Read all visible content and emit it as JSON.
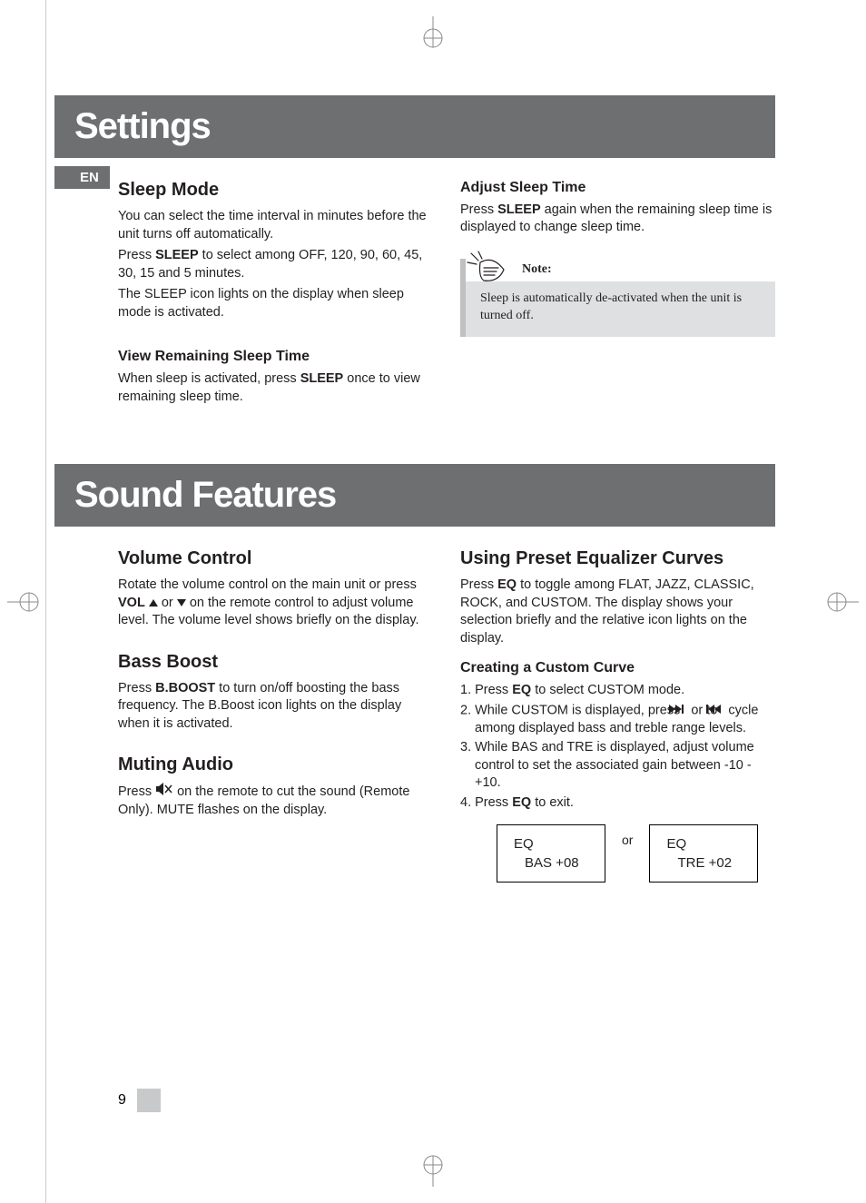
{
  "lang_tab": "EN",
  "page_number": "9",
  "settings": {
    "title": "Settings",
    "left": {
      "sleep_mode": {
        "title": "Sleep Mode",
        "p1": "You can select the time interval in minutes before the unit turns off automatically.",
        "p2a": "Press ",
        "p2b": "SLEEP",
        "p2c": " to select among OFF, 120, 90, 60, 45, 30, 15 and  5 minutes.",
        "p3": "The SLEEP icon lights on the display when sleep mode is activated."
      },
      "view_remaining": {
        "title": "View Remaining Sleep Time",
        "p1a": "When sleep is activated, press ",
        "p1b": "SLEEP",
        "p1c": " once to view remaining sleep time."
      }
    },
    "right": {
      "adjust_sleep": {
        "title": "Adjust Sleep Time",
        "p1a": "Press ",
        "p1b": "SLEEP",
        "p1c": " again when the remaining sleep time is displayed to change sleep time."
      },
      "note": {
        "label": "Note:",
        "body": "Sleep is automatically de-activated when the unit is turned off."
      }
    }
  },
  "sound": {
    "title": "Sound Features",
    "left": {
      "volume": {
        "title": "Volume Control",
        "p1a": "Rotate the volume control on the main unit or press ",
        "p1b": "VOL",
        "p1c": "  or  ",
        "p1d": "  on the remote control to adjust volume level. The volume level shows briefly on the display."
      },
      "bass": {
        "title": "Bass Boost",
        "p1a": "Press ",
        "p1b": "B.BOOST",
        "p1c": "  to turn on/off boosting the bass frequency. The B.Boost icon lights on the display when it is activated."
      },
      "mute": {
        "title": "Muting Audio",
        "p1a": "Press  ",
        "p1b": "  on the remote to cut the sound (Remote Only). MUTE flashes on the display."
      }
    },
    "right": {
      "preset_eq": {
        "title": "Using Preset Equalizer Curves",
        "p1a": "Press ",
        "p1b": "EQ",
        "p1c": " to toggle among FLAT,  JAZZ, CLASSIC, ROCK, and CUSTOM.  The display shows your selection briefly and the relative icon lights on the display."
      },
      "custom": {
        "title": "Creating a Custom Curve",
        "li1a": "1. Press ",
        "li1b": "EQ",
        "li1c": " to select CUSTOM mode.",
        "li2a": "2. While CUSTOM is displayed, press  ",
        "li2b": "  or to  ",
        "li2c": "  cycle  among displayed bass and treble range levels.",
        "li3": "3. While BAS and TRE is displayed, adjust volume control to set the associated gain between -10 - +10.",
        "li4a": "4.  Press ",
        "li4b": "EQ",
        "li4c": " to exit."
      },
      "or": "or",
      "disp1": {
        "l1": "EQ",
        "l2": "BAS   +08"
      },
      "disp2": {
        "l1": "EQ",
        "l2": "TRE   +02"
      }
    }
  }
}
